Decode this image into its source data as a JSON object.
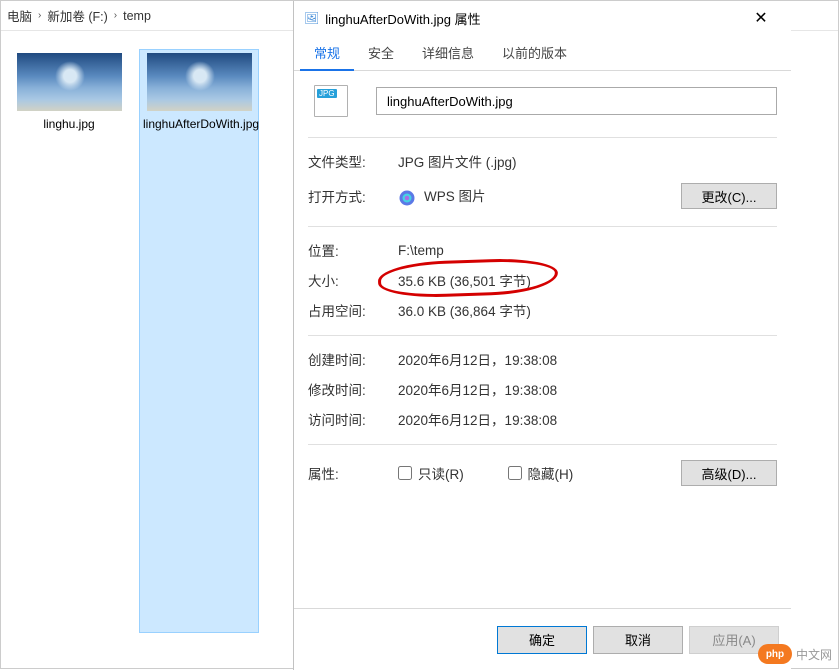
{
  "breadcrumb": {
    "part0": "电脑",
    "part1": "新加卷 (F:)",
    "part2": "temp"
  },
  "files": {
    "f1": {
      "name": "linghu.jpg"
    },
    "f2": {
      "name": "linghuAfterDoWith.jpg"
    }
  },
  "dialog": {
    "title": "linghuAfterDoWith.jpg 属性",
    "tabs": {
      "general": "常规",
      "security": "安全",
      "details": "详细信息",
      "prev": "以前的版本"
    },
    "filename": "linghuAfterDoWith.jpg",
    "labels": {
      "type": "文件类型:",
      "open": "打开方式:",
      "loc": "位置:",
      "size": "大小:",
      "ondisk": "占用空间:",
      "created": "创建时间:",
      "modified": "修改时间:",
      "accessed": "访问时间:",
      "attrs": "属性:"
    },
    "values": {
      "type": "JPG 图片文件 (.jpg)",
      "open_with": "WPS 图片",
      "change_btn": "更改(C)...",
      "loc": "F:\\temp",
      "size": "35.6 KB (36,501 字节)",
      "ondisk": "36.0 KB (36,864 字节)",
      "created": "2020年6月12日，19:38:08",
      "modified": "2020年6月12日，19:38:08",
      "accessed": "2020年6月12日，19:38:08"
    },
    "checkboxes": {
      "readonly": "只读(R)",
      "hidden": "隐藏(H)"
    },
    "advanced_btn": "高级(D)...",
    "actions": {
      "ok": "确定",
      "cancel": "取消",
      "apply": "应用(A)"
    }
  },
  "watermark": {
    "badge": "php",
    "text": "中文网"
  }
}
